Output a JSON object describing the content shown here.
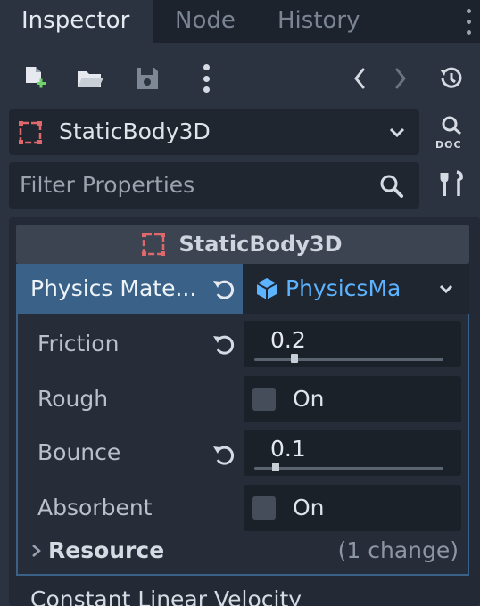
{
  "tabs": [
    {
      "label": "Inspector",
      "active": true
    },
    {
      "label": "Node",
      "active": false
    },
    {
      "label": "History",
      "active": false
    }
  ],
  "toolbar": {
    "icons": [
      "new-resource-icon",
      "open-folder-icon",
      "save-icon",
      "more-icon",
      "back-icon",
      "forward-icon",
      "history-icon"
    ]
  },
  "node_selector": {
    "value": "StaticBody3D",
    "icon": "node-icon",
    "doc_label": "DOC"
  },
  "filter": {
    "placeholder": "Filter Properties"
  },
  "class_header": {
    "title": "StaticBody3D"
  },
  "physics_material": {
    "label": "Physics Mate...",
    "resource": "PhysicsMa"
  },
  "properties": [
    {
      "label": "Friction",
      "value": "0.2",
      "slider": 0.2
    },
    {
      "label": "Rough",
      "checkbox_label": "On",
      "checked": false
    },
    {
      "label": "Bounce",
      "value": "0.1",
      "slider": 0.1
    },
    {
      "label": "Absorbent",
      "checkbox_label": "On",
      "checked": false
    }
  ],
  "resource_section": {
    "label": "Resource",
    "changes": "(1 change)"
  },
  "next_property": {
    "label": "Constant Linear Velocity"
  },
  "colors": {
    "accent": "#3a6187",
    "resource_link": "#5cb3ff",
    "node_icon": "#e0686c",
    "background": "#2b3340"
  }
}
